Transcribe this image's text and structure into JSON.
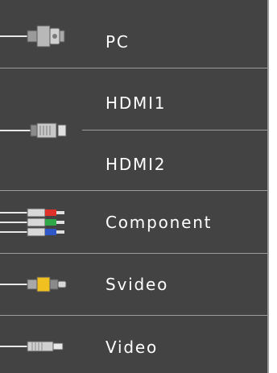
{
  "menu": {
    "items": [
      {
        "label": "PC",
        "icon": "vga-connector-icon"
      },
      {
        "label": "HDMI1",
        "icon": "hdmi-connector-icon"
      },
      {
        "label": "HDMI2",
        "icon": "hdmi-connector-icon"
      },
      {
        "label": "Component",
        "icon": "component-rgb-connector-icon"
      },
      {
        "label": "Svideo",
        "icon": "svideo-connector-icon"
      },
      {
        "label": "Video",
        "icon": "composite-video-connector-icon"
      }
    ]
  },
  "colors": {
    "panel_bg": "#434343",
    "separator": "#9c9c9c",
    "text": "#ffffff",
    "component_red": "#e0302a",
    "component_green": "#2fa84a",
    "component_blue": "#3057c8",
    "svideo_yellow": "#f0c020"
  }
}
